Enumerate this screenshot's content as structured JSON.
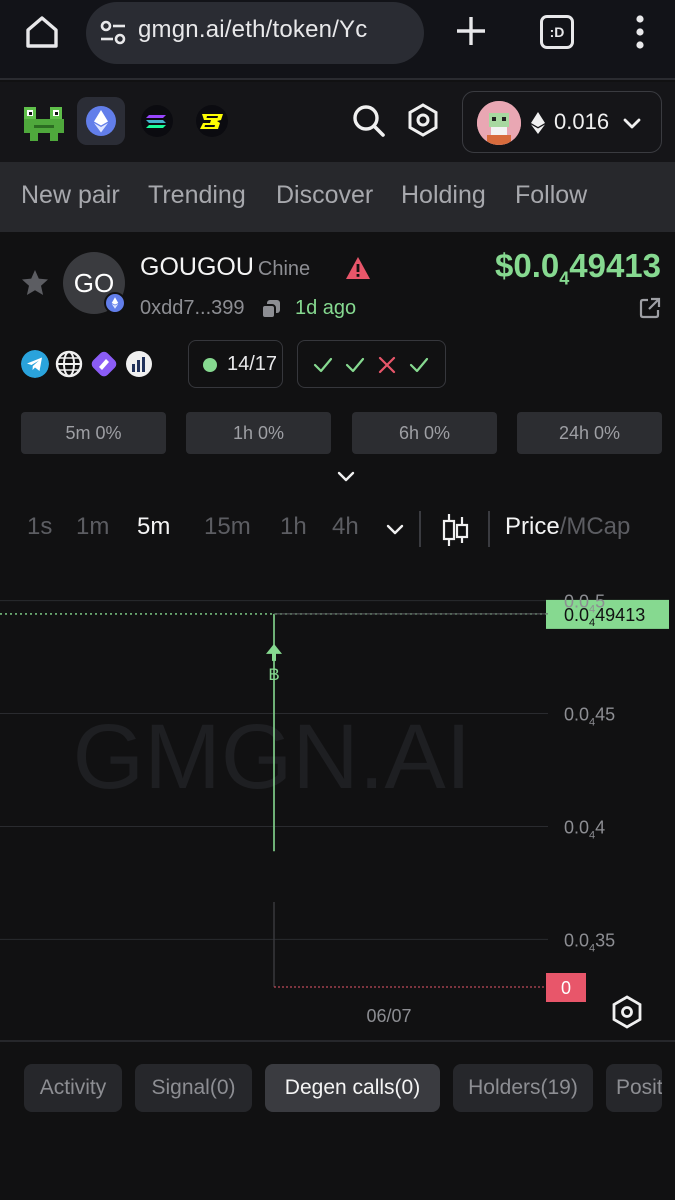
{
  "browser": {
    "url": "gmgn.ai/eth/token/Yc",
    "tab_count": ":D"
  },
  "header": {
    "chains": [
      "frog-logo",
      "ethereum",
      "solana",
      "blast"
    ],
    "wallet_balance": "0.016"
  },
  "nav": {
    "items": [
      "New pair",
      "Trending",
      "Discover",
      "Holding",
      "Follow"
    ]
  },
  "token": {
    "avatar_text": "GO",
    "symbol": "GOUGOU",
    "name": "Chine",
    "price_prefix": "$0.0",
    "price_zeros": "4",
    "price_digits": "49413",
    "address": "0xdd7...399",
    "age": "1d ago"
  },
  "audit": {
    "score": "14/17",
    "checks": [
      "pass",
      "pass",
      "fail",
      "pass"
    ]
  },
  "stats": [
    "5m 0%",
    "1h 0%",
    "6h 0%",
    "24h 0%"
  ],
  "chart_toolbar": {
    "timeframes": [
      "1s",
      "1m",
      "5m",
      "15m",
      "1h",
      "4h"
    ],
    "active_timeframe": "5m",
    "price_label": "Price",
    "separator": "/",
    "mcap_label": "MCap"
  },
  "chart_data": {
    "type": "line",
    "watermark": "GMGN.AI",
    "y_ticks": [
      {
        "prefix": "0.0",
        "sub": "4",
        "rest": "5",
        "value": 5e-05
      },
      {
        "prefix": "0.0",
        "sub": "4",
        "rest": "45",
        "value": 4.5e-05
      },
      {
        "prefix": "0.0",
        "sub": "4",
        "rest": "4",
        "value": 4e-05
      },
      {
        "prefix": "0.0",
        "sub": "4",
        "rest": "35",
        "value": 3.5e-05
      }
    ],
    "ylim": [
      3.32e-05,
      5.18e-05
    ],
    "x_ticks": [
      "06/07"
    ],
    "current_price": {
      "prefix": "0.0",
      "sub": "4",
      "rest": "49413",
      "value": 4.9413e-05
    },
    "volume_label": "0",
    "marker": "B",
    "candles": [
      {
        "open": 4.9413e-05,
        "high": 4.9413e-05,
        "low": 3.89e-05,
        "close": 4.9413e-05
      }
    ]
  },
  "bottom_tabs": [
    "Activity",
    "Signal(0)",
    "Degen calls(0)",
    "Holders(19)",
    "Posit"
  ],
  "active_bottom_tab": "Degen calls(0)",
  "colors": {
    "green": "#86d990",
    "red": "#e8566a",
    "background": "#111112"
  }
}
